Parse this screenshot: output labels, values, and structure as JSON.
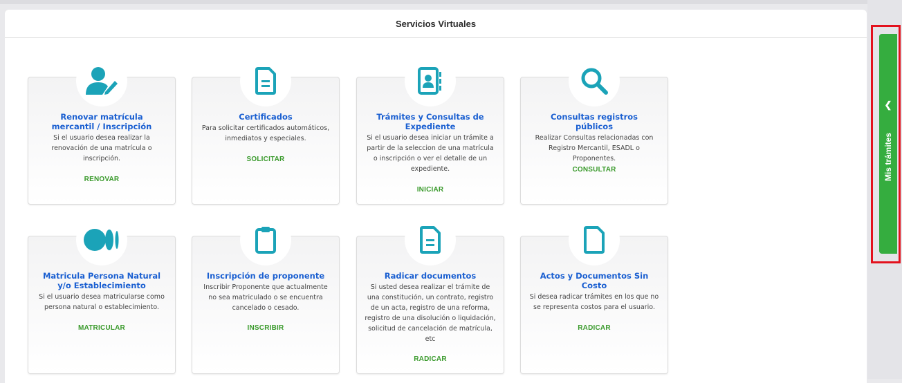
{
  "panel": {
    "title": "Servicios Virtuales"
  },
  "colors": {
    "icon": "#1ba3b8",
    "title": "#1a5fd1",
    "action": "#3a9a2c",
    "sidebar_tab": "#35ad3f",
    "highlight": "#e3111d"
  },
  "cards": [
    {
      "icon": "user-edit-icon",
      "title": "Renovar matrícula mercantil / Inscripción",
      "description": "Si el usuario desea realizar la renovación de una matrícula o inscripción.",
      "action": "RENOVAR"
    },
    {
      "icon": "document-icon",
      "title": "Certificados",
      "description": "Para solicitar certificados automáticos, inmediatos y especiales.",
      "action": "SOLICITAR"
    },
    {
      "icon": "address-book-icon",
      "title": "Trámites y Consultas de Expediente",
      "description": "Si el usuario desea iniciar un trámite a partir de la seleccion de una matrícula o inscripción o ver el detalle de un expediente.",
      "action": "INICIAR"
    },
    {
      "icon": "search-icon",
      "title": "Consultas registros públicos",
      "description": "Realizar Consultas relacionadas con Registro Mercantil, ESADL o Proponentes.",
      "action": "CONSULTAR"
    },
    {
      "icon": "circles-icon",
      "title": "Matricula Persona Natural y/o Establecimiento",
      "description": "Si el usuario desea matricularse como persona natural o establecimiento.",
      "action": "MATRICULAR"
    },
    {
      "icon": "clipboard-icon",
      "title": "Inscripción de proponente",
      "description": "Inscribir Proponente que actualmente no sea matriculado o se encuentra cancelado o cesado.",
      "action": "INSCRIBIR"
    },
    {
      "icon": "document-lines-icon",
      "title": "Radicar documentos",
      "description": "Si usted desea realizar el trámite de una constitución, un contrato, registro de un acta, registro de una reforma, registro de una disolución o liquidación, solicitud de cancelación de matrícula, etc",
      "action": "RADICAR"
    },
    {
      "icon": "blank-file-icon",
      "title": "Actos y Documentos Sin Costo",
      "description": "Si desea radicar trámites en los que no se representa costos para el usuario.",
      "action": "RADICAR"
    }
  ],
  "sidebar": {
    "tab_label": "Mis trámites",
    "toggle_icon": "chevron-left-icon"
  }
}
